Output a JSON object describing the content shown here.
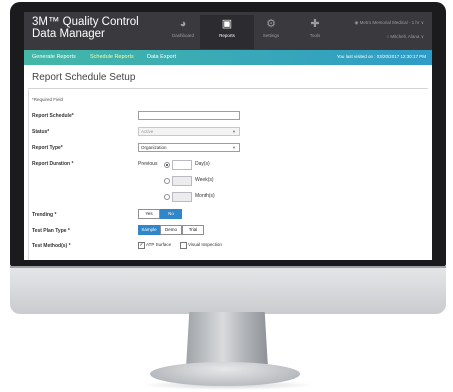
{
  "app": {
    "title_line1": "3M™ Quality Control",
    "title_line2": "Data Manager"
  },
  "nav": [
    {
      "label": "Dashboard",
      "icon": "gauge-icon"
    },
    {
      "label": "Reports",
      "icon": "document-icon"
    },
    {
      "label": "Settings",
      "icon": "gear-icon"
    },
    {
      "label": "Tools",
      "icon": "wrench-icon"
    }
  ],
  "account": {
    "site": "Metro Memorial Medical - 1 hr",
    "user": "Mitchell, Alana"
  },
  "tabs": [
    {
      "label": "Generate Reports"
    },
    {
      "label": "Schedule Reports"
    },
    {
      "label": "Data Export"
    }
  ],
  "last_visited": "You last visited on : 03/20/2017 12:30:17 PM",
  "page": {
    "title": "Report Schedule Setup",
    "required_note": "*Required Field"
  },
  "form": {
    "report_schedule_label": "Report Schedule*",
    "status_label": "Status*",
    "status_value": "Active",
    "report_type_label": "Report Type*",
    "report_type_value": "Organization",
    "report_duration_label": "Report Duration *",
    "previous_label": "Previous",
    "days_label": "Day(s)",
    "weeks_label": "Week(s)",
    "months_label": "Month(s)",
    "trending_label": "Trending *",
    "trending_yes": "Yes",
    "trending_no": "No",
    "test_plan_type_label": "Test Plan Type *",
    "plan_sample": "Sample",
    "plan_demo": "Demo",
    "plan_trial": "Trial",
    "test_methods_label": "Test Method(s) *",
    "atp_surface": "ATP Surface",
    "visual_inspection": "Visual Inspection"
  },
  "colors": {
    "appbar": "#3a3a3e",
    "tab_gradient_start": "#44b7a7",
    "tab_gradient_end": "#2e9cc6",
    "active_tab_text": "#fffb9e",
    "button_selected": "#2f86c9"
  }
}
